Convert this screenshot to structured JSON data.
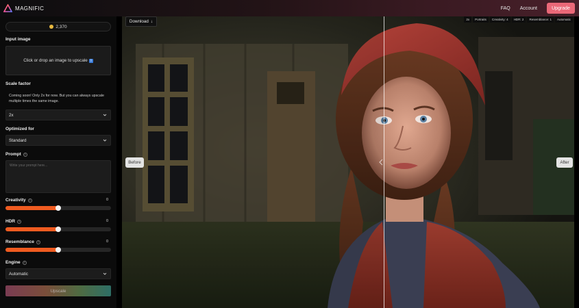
{
  "app": {
    "name": "MAGNIFIC"
  },
  "nav": {
    "faq": "FAQ",
    "account": "Account",
    "upgrade": "Upgrade"
  },
  "credits": {
    "amount": "2,370"
  },
  "input_image": {
    "label": "Input image",
    "dropzone_text": "Click or drop an image to upscale"
  },
  "scale_factor": {
    "label": "Scale factor",
    "note": "Coming soon! Only 2x for now. But you can always upscale multiple times the same image.",
    "value": "2x"
  },
  "optimized_for": {
    "label": "Optimized for",
    "value": "Standard"
  },
  "prompt": {
    "label": "Prompt",
    "placeholder": "Write your prompt here..."
  },
  "sliders": {
    "creativity": {
      "label": "Creativity",
      "value": "0",
      "level": 0.5
    },
    "hdr": {
      "label": "HDR",
      "value": "0",
      "level": 0.5
    },
    "resemblance": {
      "label": "Resemblance",
      "value": "0",
      "level": 0.5
    }
  },
  "engine": {
    "label": "Engine",
    "value": "Automatic"
  },
  "upscale_button": "Upscale",
  "image_view": {
    "download": "Download",
    "tags": [
      "2x",
      "Portraits",
      "Creativity: 4",
      "HDR: 2",
      "Resemblance: 1",
      "Automatic"
    ],
    "before": "Before",
    "after": "After",
    "comparison_position": 0.58
  },
  "colors": {
    "accent_orange": "#ef5b20",
    "upgrade_pink": "#ea6878",
    "coin_gold": "#e7b83f"
  },
  "icons": {
    "logo": "triangle-logo-icon",
    "coin": "coin-icon",
    "upload": "upload-icon",
    "info": "info-icon",
    "chevron": "chevron-down-icon",
    "download": "download-arrow-icon"
  }
}
